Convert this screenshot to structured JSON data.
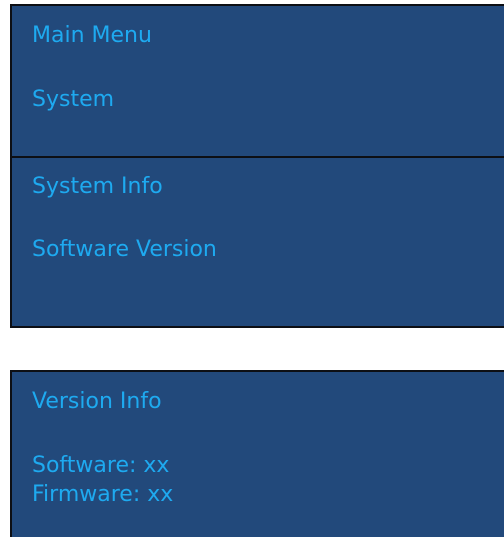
{
  "main_menu_panel": {
    "title": "Main Menu",
    "item_1": "System",
    "sub_title": "System Info",
    "sub_item_1": "Software Version"
  },
  "version_panel": {
    "title": "Version Info",
    "software_line": "Software: xx",
    "firmware_line": "Firmware: xx"
  },
  "colors": {
    "panel_background": "#22497b",
    "text": "#1eaaf0",
    "border": "#0d0f14"
  }
}
